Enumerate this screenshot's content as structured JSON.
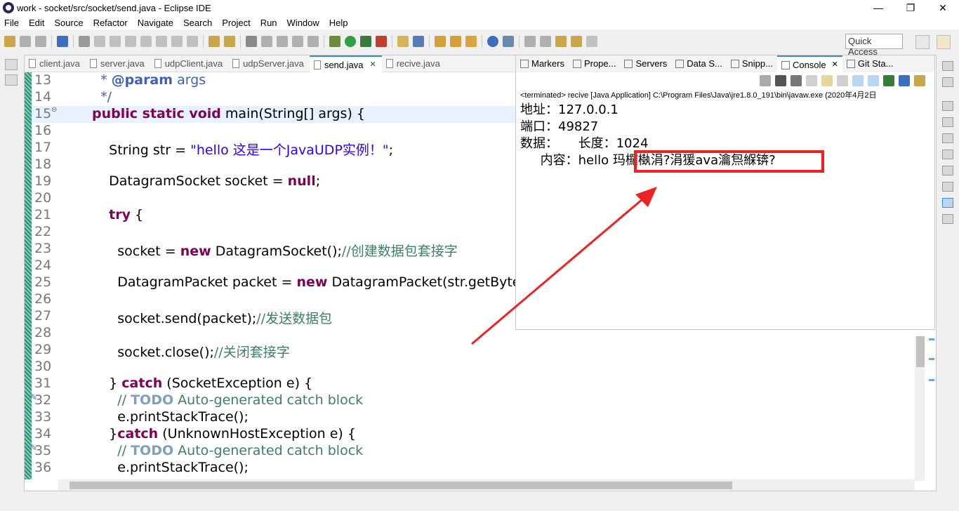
{
  "window": {
    "title": "work - socket/src/socket/send.java - Eclipse IDE",
    "minimize": "—",
    "restore": "❐",
    "close": "✕"
  },
  "menu": [
    "File",
    "Edit",
    "Source",
    "Refactor",
    "Navigate",
    "Search",
    "Project",
    "Run",
    "Window",
    "Help"
  ],
  "toolbar": {
    "quick_access": "Quick Access"
  },
  "editor": {
    "tabs": [
      {
        "label": "client.java",
        "active": false
      },
      {
        "label": "server.java",
        "active": false
      },
      {
        "label": "udpClient.java",
        "active": false
      },
      {
        "label": "udpServer.java",
        "active": false
      },
      {
        "label": "send.java",
        "active": true
      },
      {
        "label": "recive.java",
        "active": false
      }
    ],
    "lines": [
      {
        "n": "13",
        "html": "  <span class=\"jd\">* <b>@param</b> args</span>"
      },
      {
        "n": "14",
        "html": "  <span class=\"jd\">*/</span>"
      },
      {
        "n": "15",
        "html": "<span class=\"kw\">public static void</span> main(String[] args) {",
        "hl": true,
        "fold": true
      },
      {
        "n": "16",
        "html": ""
      },
      {
        "n": "17",
        "html": "    String <span class=\"field\">str</span> = <span class=\"str\">\"hello 这是一个JavaUDP实例！\"</span>;"
      },
      {
        "n": "18",
        "html": ""
      },
      {
        "n": "19",
        "html": "    DatagramSocket <span class=\"field\">socket</span> = <span class=\"kw\">null</span>;"
      },
      {
        "n": "20",
        "html": ""
      },
      {
        "n": "21",
        "html": "    <span class=\"kw\">try</span> {"
      },
      {
        "n": "22",
        "html": ""
      },
      {
        "n": "23",
        "html": "      <span class=\"field\">socket</span> = <span class=\"kw\">new</span> DatagramSocket();<span class=\"cm\">//创建数据包套接字</span>"
      },
      {
        "n": "24",
        "html": ""
      },
      {
        "n": "25",
        "html": "      DatagramPacket <span class=\"field\">packet</span> = <span class=\"kw\">new</span> DatagramPacket(<span class=\"field\">str</span>.getByte"
      },
      {
        "n": "26",
        "html": ""
      },
      {
        "n": "27",
        "html": "      <span class=\"field\">socket</span>.send(<span class=\"field\">packet</span>);<span class=\"cm\">//发送数据包</span>"
      },
      {
        "n": "28",
        "html": ""
      },
      {
        "n": "29",
        "html": "      <span class=\"field\">socket</span>.close();<span class=\"cm\">//关闭套接字</span>"
      },
      {
        "n": "30",
        "html": ""
      },
      {
        "n": "31",
        "html": "    } <span class=\"kw\">catch</span> (SocketException <span class=\"field\">e</span>) {"
      },
      {
        "n": "32",
        "html": "      <span class=\"cm\">// <span class=\"todo\">TODO</span> Auto-generated catch block</span>",
        "mark": true
      },
      {
        "n": "33",
        "html": "      <span class=\"field\">e</span>.printStackTrace();"
      },
      {
        "n": "34",
        "html": "    }<span class=\"kw\">catch</span> (UnknownHostException <span class=\"field\">e</span>) {"
      },
      {
        "n": "35",
        "html": "      <span class=\"cm\">// <span class=\"todo\">TODO</span> Auto-generated catch block</span>",
        "mark": true
      },
      {
        "n": "36",
        "html": "      <span class=\"field\">e</span>.printStackTrace();"
      }
    ]
  },
  "console": {
    "tabs": [
      {
        "label": "Markers",
        "active": false
      },
      {
        "label": "Prope...",
        "active": false
      },
      {
        "label": "Servers",
        "active": false
      },
      {
        "label": "Data S...",
        "active": false
      },
      {
        "label": "Snipp...",
        "active": false
      },
      {
        "label": "Console",
        "active": true
      },
      {
        "label": "Git Sta...",
        "active": false
      }
    ],
    "description": "<terminated> recive [Java Application] C:\\Program Files\\Java\\jre1.8.0_191\\bin\\javaw.exe (2020年4月2日",
    "output": [
      "地址：127.0.0.1",
      "端口：49827",
      "数据：     长度：1024",
      "     内容：hello 玛欏槸涓?涓猨ava瀹炰緥锛?"
    ]
  },
  "annotation": {
    "color": "#ee2222"
  }
}
